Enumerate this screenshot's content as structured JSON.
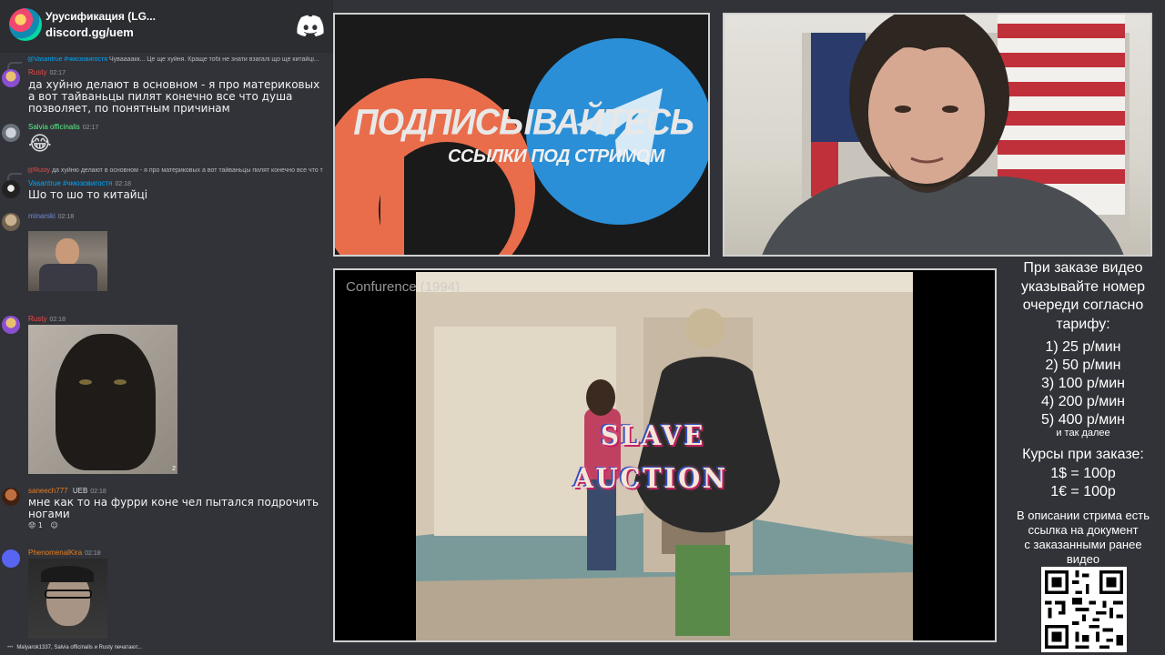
{
  "server": {
    "name": "Урусификация (LG...",
    "invite": "discord.gg/uem"
  },
  "messages": [
    {
      "reply_name": "@Vasantrue #чмозовигостя",
      "reply_text": "Чуваааакк... Це ще хуйня. Краще тобі не знати взагалі що ще китайці...",
      "author": "Rusty",
      "author_color": "#f04747",
      "time": "02:17",
      "text": "да хуйню делают в основном - я про материковых\nа вот тайваньцы пилят конечно все что душа\nпозволяет, по понятным причинам"
    },
    {
      "author": "Salvia officinalis",
      "author_color": "#57f287",
      "time": "02:17",
      "emoji": "😂"
    },
    {
      "reply_name": "@Rusty",
      "reply_text": "да хуйню делают в основном - я про материковых а вот тайваньцы пилят конечно все что т",
      "author": "Vasantrue #чмозовигостя",
      "author_color": "#00a8fc",
      "time": "02:18",
      "text": "Шо то шо то китайці"
    },
    {
      "author": "minarski",
      "author_color": "#7289da",
      "time": "02:18"
    },
    {
      "author": "Rusty",
      "author_color": "#f04747",
      "time": "02:18",
      "image_badge": "2"
    },
    {
      "author": "saneech777",
      "author_color": "#e67e22",
      "badge": "UEB",
      "time": "02:18",
      "text": "мне как то на фурри коне чел пытался подрочить\nногами",
      "reaction_count": "1"
    },
    {
      "author": "PhenomenalKira",
      "author_color": "#e67e22",
      "time": "02:18"
    }
  ],
  "typing": "Malyarok1337, Salvia officinalis и Rusty печатают...",
  "banner": {
    "title": "ПОДПИСЫВАЙТЕСЬ",
    "subtitle": "ССЫЛКИ ПОД СТРИМОМ"
  },
  "video": {
    "title": "Confurence (1994)",
    "caption_line1": "SLAVE",
    "caption_line2": "AUCTION"
  },
  "pricing": {
    "intro": [
      "При заказе видео",
      "указывайте номер",
      "очереди согласно",
      "тарифу:"
    ],
    "tiers": [
      "1) 25 р/мин",
      "2) 50 р/мин",
      "3) 100 р/мин",
      "4) 200 р/мин",
      "5) 400 р/мин"
    ],
    "more": "и так далее",
    "rates_title": "Курсы при заказе:",
    "rates": [
      "1$ = 100р",
      "1€ = 100р"
    ],
    "description": [
      "В описании стрима есть",
      "ссылка на документ",
      "с заказанными ранее",
      "видео"
    ]
  }
}
